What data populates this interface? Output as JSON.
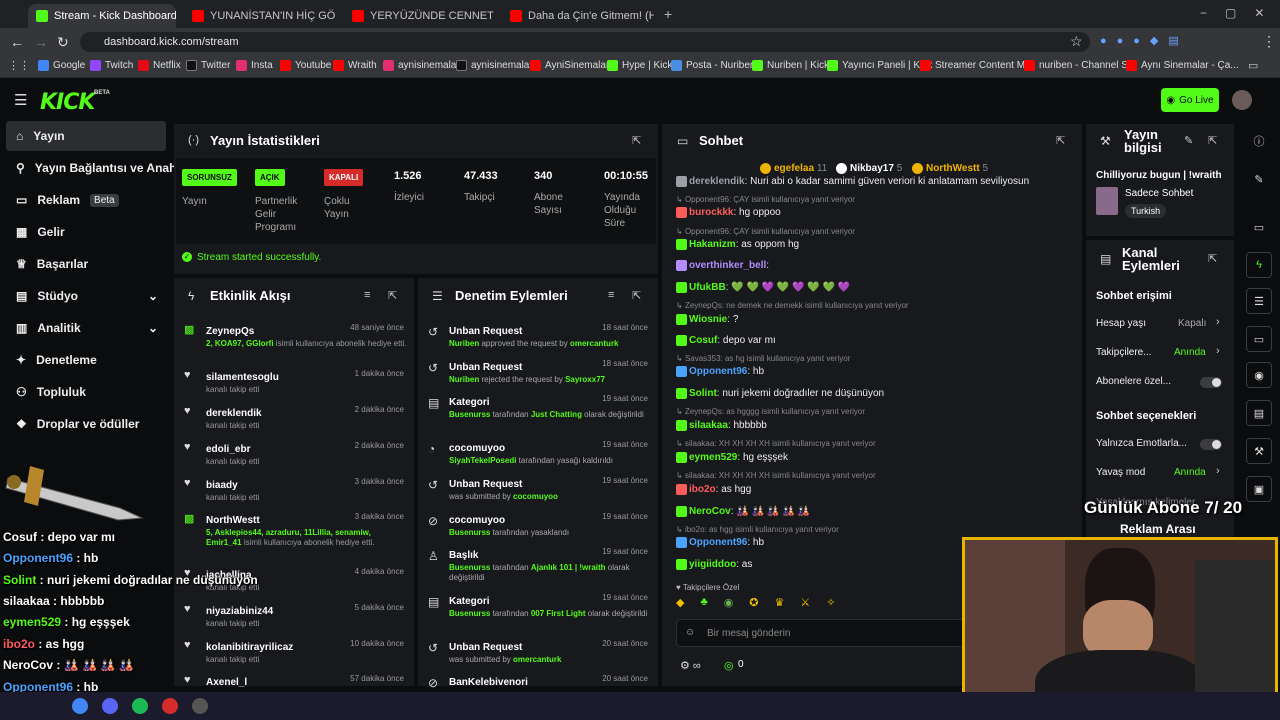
{
  "browser": {
    "tabs": [
      {
        "label": "Stream - Kick Dashboard",
        "color": "#53fc18"
      },
      {
        "label": "YUNANİSTAN'IN HİÇ GÖSTERİL",
        "color": "#ff0000"
      },
      {
        "label": "YERYÜZÜNDE CENNETİ BULDU",
        "color": "#ff0000"
      },
      {
        "label": "Daha da Çin'e Gitmem! (Hafta",
        "color": "#ff0000"
      }
    ],
    "url": "dashboard.kick.com/stream",
    "bookmarks": [
      "Google",
      "Twitch",
      "Netflix",
      "Twitter",
      "Insta",
      "Youtube",
      "Wraith",
      "aynisinemalar",
      "aynisinemalar",
      "AyniSinemalar",
      "Hype | Kick",
      "Posta - Nuriben",
      "Nuriben | Kick",
      "Yayıncı Paneli | Kick",
      "Streamer Content M...",
      "nuriben - Channel S...",
      "Aynı Sinemalar - Ça..."
    ]
  },
  "header": {
    "logo": "KICK",
    "logo_sup": "BETA",
    "go_live": "Go Live"
  },
  "sidebar": {
    "items": [
      {
        "label": "Yayın",
        "icon": "home-icon"
      },
      {
        "label": "Yayın Bağlantısı ve Anahtar",
        "icon": "link-icon"
      },
      {
        "label": "Reklam",
        "icon": "ad-icon",
        "badge": "Beta"
      },
      {
        "label": "Gelir",
        "icon": "money-icon"
      },
      {
        "label": "Başarılar",
        "icon": "trophy-icon"
      },
      {
        "label": "Stüdyo",
        "icon": "studio-icon"
      },
      {
        "label": "Analitik",
        "icon": "chart-icon"
      },
      {
        "label": "Denetleme",
        "icon": "mod-icon"
      },
      {
        "label": "Topluluk",
        "icon": "community-icon"
      },
      {
        "label": "Droplar ve ödüller",
        "icon": "gift-icon"
      }
    ]
  },
  "stats": {
    "title": "Yayın İstatistikleri",
    "cells": [
      {
        "badge": "SORUNSUZ",
        "label": "Yayın"
      },
      {
        "badge": "AÇIK",
        "label": "Partnerlik Gelir Programı"
      },
      {
        "badge": "KAPALI",
        "label": "Çoklu Yayın"
      },
      {
        "value": "1.526",
        "label": "İzleyici"
      },
      {
        "value": "47.433",
        "label": "Takipçi"
      },
      {
        "value": "340",
        "label": "Abone Sayısı"
      },
      {
        "value": "00:10:55",
        "label": "Yayında Olduğu Süre"
      }
    ],
    "success": "Stream started successfully."
  },
  "activity": {
    "title": "Etkinlik Akışı",
    "items": [
      {
        "name": "ZeynepQs",
        "time": "48 saniye önce",
        "sub_green": "2, KOA97, GGlorfi",
        "sub": " isimli kullanıcıya abonelik hediye etti."
      },
      {
        "name": "silamentesoglu",
        "time": "1 dakika önce",
        "sub": "kanalı takip etti"
      },
      {
        "name": "dereklendik",
        "time": "2 dakika önce",
        "sub": "kanalı takip etti"
      },
      {
        "name": "edoli_ebr",
        "time": "2 dakika önce",
        "sub": "kanalı takip etti"
      },
      {
        "name": "biaady",
        "time": "3 dakika önce",
        "sub": "kanalı takip etti"
      },
      {
        "name": "NorthWestt",
        "time": "3 dakika önce",
        "sub_green": "5, Asklepios44, azraduru, 11Lillia, senamiw, Emir1_41",
        "sub": " isimli kullanıcıya abonelik hediye etti."
      },
      {
        "name": "jachellina",
        "time": "4 dakika önce",
        "sub": "kanalı takip etti"
      },
      {
        "name": "niyaziabiniz44",
        "time": "5 dakika önce",
        "sub": "kanalı takip etti"
      },
      {
        "name": "kolanibitirayrilicaz",
        "time": "10 dakika önce",
        "sub": "kanalı takip etti"
      },
      {
        "name": "Axenel_l",
        "time": "57 dakika önce",
        "sub": ""
      }
    ]
  },
  "moderation": {
    "title": "Denetim Eylemleri",
    "items": [
      {
        "name": "Unban Request",
        "time": "18 saat önce",
        "a": "Nuriben",
        "mid": " approved the request by ",
        "b": "omercanturk",
        "tail": ""
      },
      {
        "name": "Unban Request",
        "time": "18 saat önce",
        "a": "Nuriben",
        "mid": " rejected the request by ",
        "b": "Sayroxx77",
        "tail": ""
      },
      {
        "name": "Kategori",
        "time": "19 saat önce",
        "a": "Busenurss",
        "mid": " tarafından ",
        "b": "Just Chatting",
        "tail": " olarak değiştirildi"
      },
      {
        "name": "cocomuyoo",
        "time": "19 saat önce",
        "a": "SiyahTekelPosedi",
        "mid": " tarafından yasağı kaldırıldı",
        "b": "",
        "tail": ""
      },
      {
        "name": "Unban Request",
        "time": "19 saat önce",
        "a": "",
        "mid": "was submitted by ",
        "b": "cocomuyoo",
        "tail": ""
      },
      {
        "name": "cocomuyoo",
        "time": "19 saat önce",
        "a": "Busenurss",
        "mid": " tarafından yasaklandı",
        "b": "",
        "tail": ""
      },
      {
        "name": "Başlık",
        "time": "19 saat önce",
        "a": "Busenurss",
        "mid": " tarafından ",
        "b": "Ajanlık 101 | !wraith",
        "tail": " olarak değiştirildi"
      },
      {
        "name": "Kategori",
        "time": "19 saat önce",
        "a": "Busenurss",
        "mid": " tarafından ",
        "b": "007 First Light",
        "tail": " olarak değiştirildi"
      },
      {
        "name": "Unban Request",
        "time": "20 saat önce",
        "a": "",
        "mid": "was submitted by ",
        "b": "omercanturk",
        "tail": ""
      },
      {
        "name": "BanKelebivenori",
        "time": "20 saat önce",
        "a": "",
        "mid": "",
        "b": "",
        "tail": ""
      }
    ]
  },
  "chat": {
    "title": "Sohbet",
    "top_gifters": [
      {
        "name": "egefelaa",
        "count": "11",
        "color": "#f0b400"
      },
      {
        "name": "Nikbay17",
        "count": "5",
        "color": "#ffffff"
      },
      {
        "name": "NorthWestt",
        "count": "5",
        "color": "#f0b400"
      }
    ],
    "lines": [
      {
        "type": "msg",
        "user": "dereklendik",
        "text": "Nuri abi o kadar samimi güven veriori ki anlatamam seviliyosun",
        "color": "#9aa0a6"
      },
      {
        "type": "reply",
        "text": "Opponent96: ÇAY isimli kullanıcıya yanıt veriyor"
      },
      {
        "type": "msg",
        "user": "burockkk",
        "text": "hg oppoo",
        "color": "#ff5c5c"
      },
      {
        "type": "reply",
        "text": "Opponent96: ÇAY isimli kullanıcıya yanıt veriyor"
      },
      {
        "type": "msg",
        "user": "Hakanizm",
        "text": "as oppom hg",
        "color": "#53fc18"
      },
      {
        "type": "msg",
        "user": "overthinker_bell",
        "text": "",
        "color": "#b38cff"
      },
      {
        "type": "msg",
        "user": "UfukBB",
        "text": "💚 💚 💜 💚 💜 💚 💚 💜",
        "color": "#53fc18"
      },
      {
        "type": "reply",
        "text": "ZeynepQs: ne demek ne demekk isimli kullanıcıya yanıt veriyor"
      },
      {
        "type": "msg",
        "user": "Wiosnie",
        "text": "?",
        "color": "#53fc18"
      },
      {
        "type": "msg",
        "user": "Cosuf",
        "text": "depo var mı",
        "color": "#53fc18"
      },
      {
        "type": "reply",
        "text": "Savas353: as hg isimli kullanıcıya yanıt veriyor"
      },
      {
        "type": "msg",
        "user": "Opponent96",
        "text": "hb",
        "color": "#4aa3ff"
      },
      {
        "type": "msg",
        "user": "Solint",
        "text": "nuri jekemi doğradıler ne düşünüyon",
        "color": "#53fc18"
      },
      {
        "type": "reply",
        "text": "ZeynepQs: as hgggg isimli kullanıcıya yanıt veriyor"
      },
      {
        "type": "msg",
        "user": "silaakaa",
        "text": "hbbbbb",
        "color": "#53fc18"
      },
      {
        "type": "reply",
        "text": "silaakaa: XH XH XH XH isimli kullanıcıya yanıt veriyor"
      },
      {
        "type": "msg",
        "user": "eymen529",
        "text": "hg eşşşek",
        "color": "#53fc18"
      },
      {
        "type": "reply",
        "text": "silaakaa: XH XH XH XH isimli kullanıcıya yanıt veriyor"
      },
      {
        "type": "msg",
        "user": "ibo2o",
        "text": "as hgg",
        "color": "#ff5c5c"
      },
      {
        "type": "msg",
        "user": "NeroCov",
        "text": "🎎 🎎 🎎 🎎 🎎",
        "color": "#53fc18"
      },
      {
        "type": "reply",
        "text": "ibo2o: as hgg isimli kullanıcıya yanıt veriyor"
      },
      {
        "type": "msg",
        "user": "Opponent96",
        "text": "hb",
        "color": "#4aa3ff"
      },
      {
        "type": "msg",
        "user": "yiigiiddoo",
        "text": "as",
        "color": "#53fc18"
      }
    ],
    "follower_only": "Takipçilere Özel",
    "input_placeholder": "Bir mesaj gönderin",
    "footer_count": "0"
  },
  "stream_info": {
    "title": "Yayın bilgisi",
    "stream_title": "Chilliyoruz bugun | !wraith",
    "category": "Sadece Sohbet",
    "language": "Turkish"
  },
  "channel_actions": {
    "title": "Kanal Eylemleri",
    "chat_access": "Sohbet erişimi",
    "rows": [
      {
        "label": "Hesap yaşı",
        "value": "Kapalı",
        "type": "select",
        "green": false
      },
      {
        "label": "Takipçilere...",
        "value": "Anında",
        "type": "select",
        "green": true
      },
      {
        "label": "Abonelere özel...",
        "value": "",
        "type": "toggle",
        "green": false
      }
    ],
    "chat_options": "Sohbet seçenekleri",
    "rows2": [
      {
        "label": "Yalnızca Emotlarla...",
        "value": "",
        "type": "toggle",
        "green": false
      },
      {
        "label": "Yavaş mod",
        "value": "Anında",
        "type": "select",
        "green": true
      }
    ],
    "partial": "Yasaklanmış kelimeler",
    "ad_break": "Reklam Arası"
  },
  "overlay": {
    "sub_goal": "Günlük Abone 7/ 20",
    "chat": [
      {
        "user": "Cosuf",
        "text": " : depo var mı",
        "color": "#ffffff"
      },
      {
        "user": "Opponent96",
        "text": " : hb",
        "color": "#4aa3ff"
      },
      {
        "user": "Solint",
        "text": " : nuri jekemi doğradılar ne düşünüyon",
        "color": "#53fc18"
      },
      {
        "user": "silaakaa",
        "text": " : hbbbbb",
        "color": "#ffffff"
      },
      {
        "user": "eymen529",
        "text": " : hg eşşşek",
        "color": "#53fc18"
      },
      {
        "user": "ibo2o",
        "text": " : as hgg",
        "color": "#ff5c5c"
      },
      {
        "user": "NeroCov",
        "text": " : 🎎 🎎 🎎 🎎",
        "color": "#ffffff"
      },
      {
        "user": "Opponent96",
        "text": " : hb",
        "color": "#4aa3ff"
      },
      {
        "user": "yiigiiddoo",
        "text": " : as",
        "color": "#ffffff"
      }
    ]
  }
}
